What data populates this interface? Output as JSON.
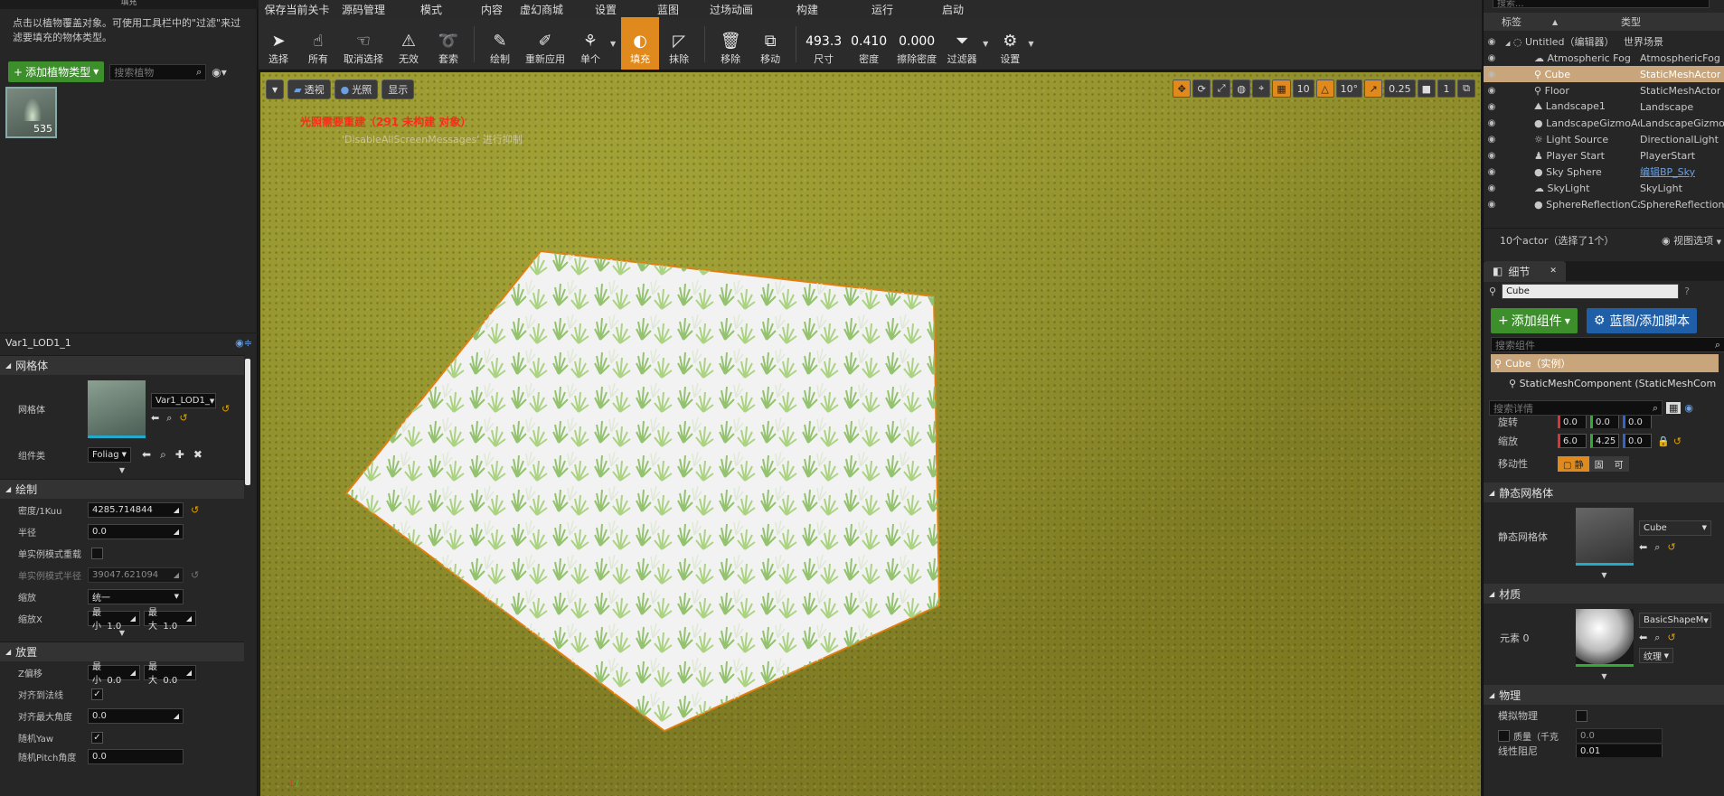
{
  "left": {
    "header_title": "填充",
    "description": "点击以植物覆盖对象。可使用工具栏中的\"过滤\"来过滤要填充的物体类型。",
    "add_foliage_label": "添加植物类型",
    "search_placeholder": "搜索植物",
    "foliage_count": "535",
    "selected_type": "Var1_LOD1_1",
    "sections": {
      "mesh": "网格体",
      "paint": "绘制",
      "placement": "放置"
    },
    "mesh": {
      "mesh_label": "网格体",
      "mesh_value": "Var1_LOD1_",
      "component_label": "组件类",
      "component_value": "Foliag"
    },
    "paint": {
      "density_label": "密度/1Kuu",
      "density_value": "4285.714844",
      "radius_label": "半径",
      "radius_value": "0.0",
      "single_override_label": "单实例模式重载",
      "single_radius_label": "单实例模式半径",
      "single_radius_value": "39047.621094",
      "scale_label": "缩放",
      "scale_value": "统一",
      "scalex_label": "缩放X",
      "min_label": "最小",
      "min_value": "1.0",
      "max_label": "最大",
      "max_value": "1.0"
    },
    "placement": {
      "zoffset_label": "Z偏移",
      "z_min_label": "最小",
      "z_min": "0.0",
      "z_max_label": "最大",
      "z_max": "0.0",
      "align_normal_label": "对齐到法线",
      "align_max_label": "对齐最大角度",
      "align_max_value": "0.0",
      "random_yaw_label": "随机Yaw",
      "random_pitch_label": "随机Pitch角度",
      "random_pitch_value": "0.0"
    }
  },
  "menubar": [
    "保存当前关卡",
    "源码管理",
    "模式",
    "内容",
    "虚幻商城",
    "设置",
    "蓝图",
    "过场动画",
    "构建",
    "运行",
    "启动"
  ],
  "toolbar": {
    "select": "选择",
    "all": "所有",
    "deselect": "取消选择",
    "invalid": "无效",
    "lasso": "套索",
    "paint": "绘制",
    "reapply": "重新应用",
    "single": "单个",
    "fill": "填充",
    "erase": "抹除",
    "remove": "移除",
    "move": "移动",
    "size_value": "493.3",
    "size_label": "尺寸",
    "density_value": "0.410",
    "density_label": "密度",
    "erase_density_value": "0.000",
    "erase_density_label": "擦除密度",
    "filter": "过滤器",
    "settings": "设置"
  },
  "viewport": {
    "perspective": "透视",
    "lit": "光照",
    "show": "显示",
    "grid_snap": "10",
    "rot_snap": "10°",
    "scale_snap": "0.25",
    "cam_speed": "1",
    "warning": "光照需要重建（291 未构建 对象）",
    "warning2": "'DisableAllScreenMessages' 进行抑制"
  },
  "outliner": {
    "search_placeholder": "搜索...",
    "col_label": "标签",
    "col_type": "类型",
    "rows": [
      {
        "name": "Untitled（编辑器）",
        "type": "世界场景"
      },
      {
        "name": "Atmospheric Fog",
        "type": "AtmosphericFog"
      },
      {
        "name": "Cube",
        "type": "StaticMeshActor"
      },
      {
        "name": "Floor",
        "type": "StaticMeshActor"
      },
      {
        "name": "Landscape1",
        "type": "Landscape"
      },
      {
        "name": "LandscapeGizmoActiveActor",
        "type": "LandscapeGizmo"
      },
      {
        "name": "Light Source",
        "type": "DirectionalLight"
      },
      {
        "name": "Player Start",
        "type": "PlayerStart"
      },
      {
        "name": "Sky Sphere",
        "type": "编辑BP_Sky"
      },
      {
        "name": "SkyLight",
        "type": "SkyLight"
      },
      {
        "name": "SphereReflectionCapture",
        "type": "SphereReflection"
      }
    ],
    "footer": "10个actor（选择了1个）",
    "view_options": "视图选项"
  },
  "details": {
    "tab": "细节",
    "actor_name": "Cube",
    "add_component": "添加组件",
    "blueprint": "蓝图/添加脚本",
    "search_component_placeholder": "搜索组件",
    "instance_label": "Cube（实例）",
    "component_item": "StaticMeshComponent (StaticMeshCom",
    "search_details_placeholder": "搜索详情",
    "rotation_label": "旋转",
    "rot": [
      "0.0",
      "0.0",
      "0.0"
    ],
    "scale_label": "缩放",
    "scale": [
      "6.0",
      "4.25",
      "0.0"
    ],
    "mobility_label": "移动性",
    "mobility": [
      "静",
      "固",
      "可"
    ],
    "static_mesh_section": "静态网格体",
    "static_mesh_label": "静态网格体",
    "static_mesh_value": "Cube",
    "materials_section": "材质",
    "element_label": "元素 0",
    "material_value": "BasicShapeM",
    "texture_label": "纹理",
    "physics_section": "物理",
    "simulate_label": "模拟物理",
    "mass_label": "质量（千克",
    "mass_value": "0.0",
    "linear_damping_label": "线性阻尼",
    "linear_damping_value": "0.01"
  }
}
